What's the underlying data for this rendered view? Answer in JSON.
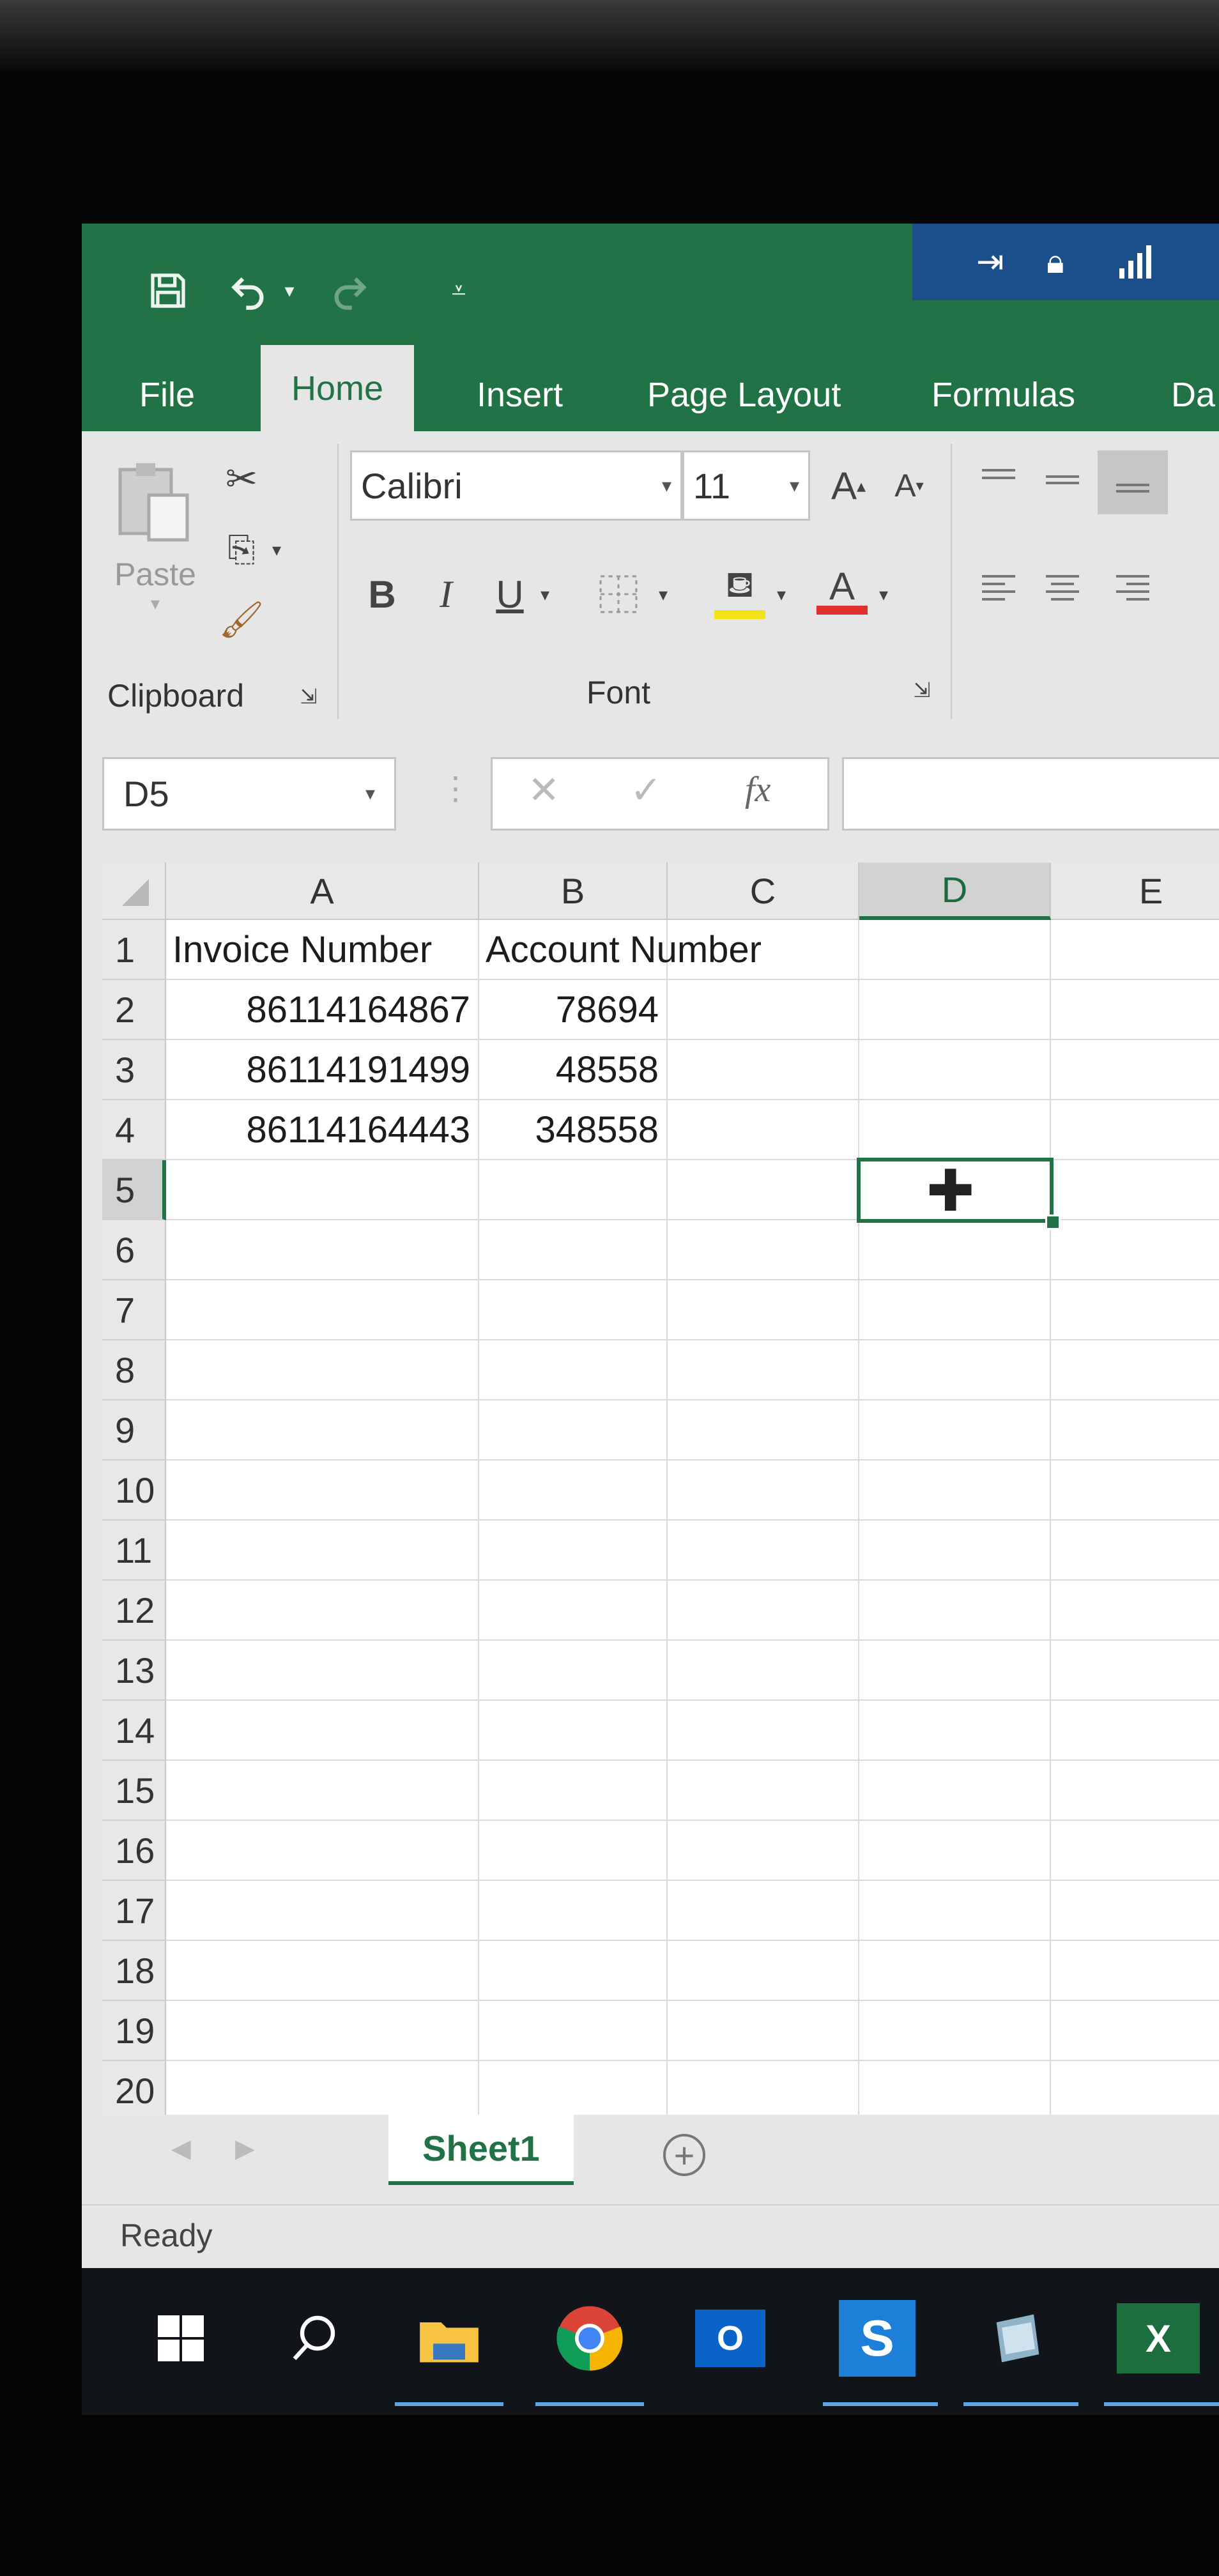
{
  "titlebar": {
    "save_icon": "save-icon",
    "undo_icon": "undo-icon",
    "redo_icon": "redo-icon",
    "customize_icon": "customize-qat-icon"
  },
  "tabs": [
    "File",
    "Home",
    "Insert",
    "Page Layout",
    "Formulas",
    "Da"
  ],
  "ribbon": {
    "clipboard": {
      "paste_label": "Paste",
      "group_label": "Clipboard"
    },
    "font": {
      "font_name": "Calibri",
      "font_size": "11",
      "bold": "B",
      "italic": "I",
      "underline": "U",
      "grow_font": "A",
      "shrink_font": "A",
      "font_color": "A",
      "group_label": "Font"
    }
  },
  "formula_bar": {
    "name_box": "D5",
    "cancel": "✕",
    "enter": "✓",
    "fx": "fx",
    "formula": ""
  },
  "grid": {
    "columns": [
      "A",
      "B",
      "C",
      "D",
      "E"
    ],
    "rows": [
      "1",
      "2",
      "3",
      "4",
      "5",
      "6",
      "7",
      "8",
      "9",
      "10",
      "11",
      "12",
      "13",
      "14",
      "15",
      "16",
      "17",
      "18",
      "19",
      "20"
    ],
    "cells": {
      "A1": "Invoice Number",
      "B1": "Account Number",
      "A2": "86114164867",
      "B2": "78694",
      "A3": "86114191499",
      "B3": "48558",
      "A4": "86114164443",
      "B4": "348558"
    },
    "selected_cell": "D5"
  },
  "sheets": {
    "active": "Sheet1",
    "add_label": "+"
  },
  "status": {
    "text": "Ready"
  },
  "taskbar": {
    "items": [
      "windows-start-icon",
      "search-icon",
      "file-explorer-icon",
      "chrome-icon",
      "outlook-icon",
      "skype-icon",
      "notes-icon",
      "excel-icon"
    ],
    "outlook_text": "O",
    "skype_text": "S",
    "excel_text": "X"
  },
  "colors": {
    "excel_green": "#217346",
    "ribbon_bg": "#e6e6e6",
    "taskbar_bg": "#111418"
  }
}
